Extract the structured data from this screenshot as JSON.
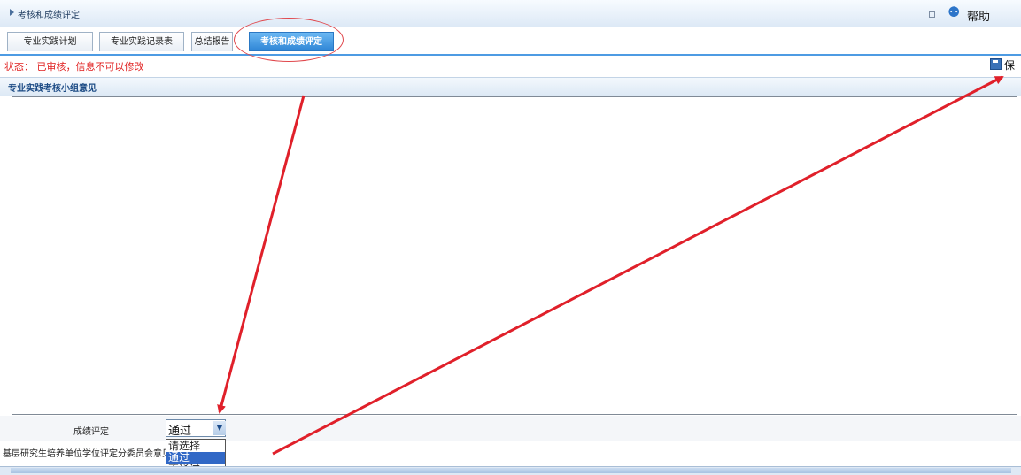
{
  "title": "考核和成绩评定",
  "help": "帮助",
  "tabs": [
    {
      "label": "专业实践计划"
    },
    {
      "label": "专业实践记录表"
    },
    {
      "label": "总结报告"
    },
    {
      "label": "考核和成绩评定"
    }
  ],
  "active_tab": "考核和成绩评定",
  "status": "状态：  已审核，信息不可以修改",
  "save_label": "保存",
  "opinion": {
    "label": "专业实践考核小组意见",
    "value": ""
  },
  "grade": {
    "label": "成绩评定",
    "selected": "通过",
    "options": [
      "请选择",
      "通过",
      "不通过"
    ]
  },
  "committee_label": "基层研究生培养单位学位评定分委员会意见",
  "colors": {
    "accent": "#2f86d6",
    "annotation": "#e0202a",
    "status": "#e02020"
  },
  "icons": [
    "triangle-right-icon",
    "minimize-icon",
    "help-icon",
    "save-icon",
    "chevron-down-icon"
  ]
}
